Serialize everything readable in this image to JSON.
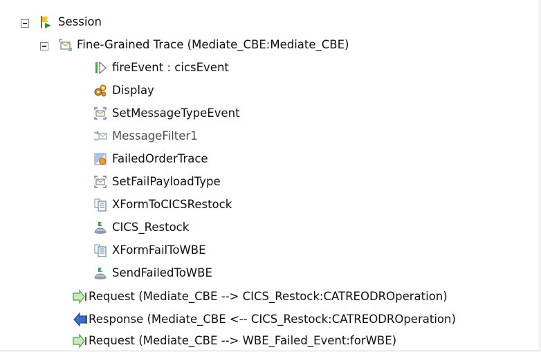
{
  "tree": {
    "session": {
      "label": "Session",
      "icon": "session-flag-icon"
    },
    "trace": {
      "label": "Fine-Grained Trace (Mediate_CBE:Mediate_CBE)",
      "icon": "fine-grained-trace-icon"
    },
    "children": [
      {
        "label": "fireEvent : cicsEvent",
        "icon": "fire-event-icon"
      },
      {
        "label": "Display",
        "icon": "display-gears-icon"
      },
      {
        "label": "SetMessageTypeEvent",
        "icon": "envelope-bracket-icon"
      },
      {
        "label": "MessageFilter1",
        "icon": "message-filter-icon"
      },
      {
        "label": "FailedOrderTrace",
        "icon": "trace-node-icon"
      },
      {
        "label": "SetFailPayloadType",
        "icon": "envelope-bracket-icon"
      },
      {
        "label": "XFormToCICSRestock",
        "icon": "xform-document-icon"
      },
      {
        "label": "CICS_Restock",
        "icon": "service-invoke-icon"
      },
      {
        "label": "XFormFailToWBE",
        "icon": "xform-document-icon"
      },
      {
        "label": "SendFailedToWBE",
        "icon": "service-invoke-icon"
      }
    ],
    "messages": [
      {
        "label": "Request (Mediate_CBE --> CICS_Restock:CATREODROperation)",
        "icon": "request-arrow-icon"
      },
      {
        "label": "Response (Mediate_CBE <-- CICS_Restock:CATREODROperation)",
        "icon": "response-arrow-icon"
      },
      {
        "label": "Request (Mediate_CBE --> WBE_Failed_Event:forWBE)",
        "icon": "request-arrow-icon"
      }
    ]
  }
}
